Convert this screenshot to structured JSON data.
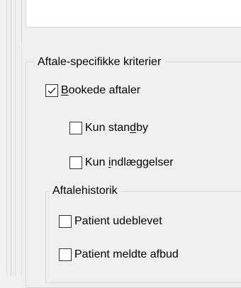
{
  "group": {
    "title": "Aftale-specifikke kriterier"
  },
  "options": {
    "booked": {
      "label_pre": "",
      "label_mnemonic": "B",
      "label_post": "ookede aftaler",
      "checked": true
    },
    "standby": {
      "label_pre": "Kun stan",
      "label_mnemonic": "d",
      "label_post": "by",
      "checked": false
    },
    "admissions": {
      "label_pre": "Kun ",
      "label_mnemonic": "i",
      "label_post": "ndlæggelser",
      "checked": false
    }
  },
  "history": {
    "title": "Aftalehistorik",
    "no_show": {
      "label": "Patient udeblevet",
      "checked": false
    },
    "cancelled": {
      "label": "Patient meldte afbud",
      "checked": false
    }
  }
}
